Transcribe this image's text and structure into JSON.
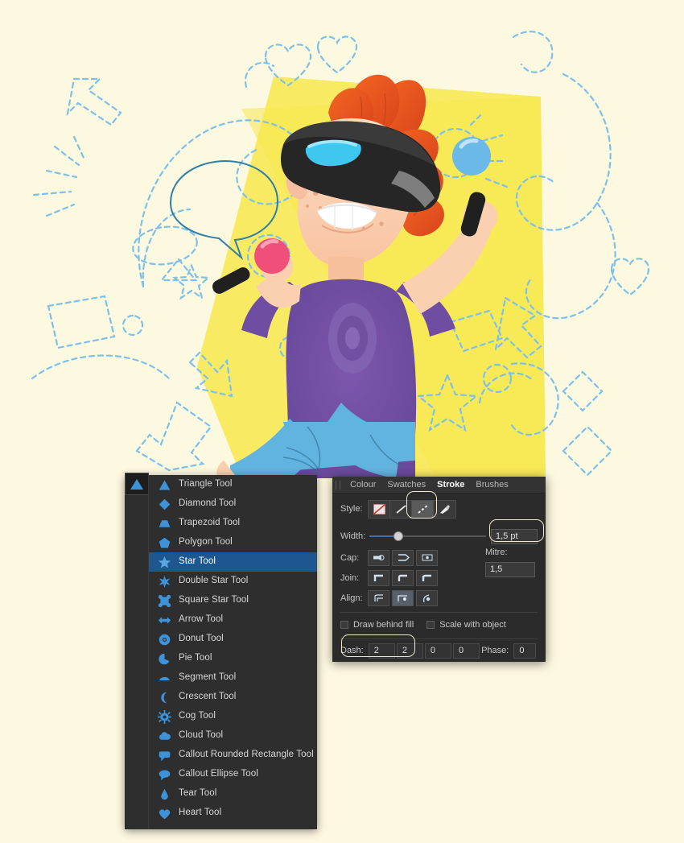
{
  "app": {
    "illustration_alt": "Cartoon boy with orange hair wearing a VR headset holding two controllers, yellow backdrop with dashed blue vector shapes"
  },
  "colors": {
    "page_background": "#fdf8e0",
    "backdrop_yellow": "#f7e94f",
    "dashed_stroke": "#6fb7e8",
    "hair_orange": "#e8561f",
    "shirt_purple": "#6f4da0",
    "jeans_blue": "#62b4e0",
    "skin": "#fbd0b0",
    "headset_black": "#2b2b2b",
    "headset_glow": "#3ec8f0",
    "controller_pink": "#ef4f78",
    "controller_blue": "#6bb9e8",
    "menu_background": "#2e2e2e",
    "menu_selected": "#1e568f",
    "panel_background": "#2b2b2b",
    "icon_blue": "#3e93d8"
  },
  "tool_menu": {
    "current_tool_icon": "triangle-icon",
    "items": [
      {
        "label": "Triangle Tool",
        "icon": "triangle-icon",
        "selected": false
      },
      {
        "label": "Diamond Tool",
        "icon": "diamond-icon",
        "selected": false
      },
      {
        "label": "Trapezoid Tool",
        "icon": "trapezoid-icon",
        "selected": false
      },
      {
        "label": "Polygon Tool",
        "icon": "polygon-icon",
        "selected": false
      },
      {
        "label": "Star Tool",
        "icon": "star-icon",
        "selected": true
      },
      {
        "label": "Double Star Tool",
        "icon": "double-star-icon",
        "selected": false
      },
      {
        "label": "Square Star Tool",
        "icon": "square-star-icon",
        "selected": false
      },
      {
        "label": "Arrow Tool",
        "icon": "arrow-icon",
        "selected": false
      },
      {
        "label": "Donut Tool",
        "icon": "donut-icon",
        "selected": false
      },
      {
        "label": "Pie Tool",
        "icon": "pie-icon",
        "selected": false
      },
      {
        "label": "Segment Tool",
        "icon": "segment-icon",
        "selected": false
      },
      {
        "label": "Crescent Tool",
        "icon": "crescent-icon",
        "selected": false
      },
      {
        "label": "Cog Tool",
        "icon": "cog-icon",
        "selected": false
      },
      {
        "label": "Cloud Tool",
        "icon": "cloud-icon",
        "selected": false
      },
      {
        "label": "Callout Rounded Rectangle Tool",
        "icon": "callout-rounded-rect-icon",
        "selected": false
      },
      {
        "label": "Callout Ellipse Tool",
        "icon": "callout-ellipse-icon",
        "selected": false
      },
      {
        "label": "Tear Tool",
        "icon": "tear-icon",
        "selected": false
      },
      {
        "label": "Heart Tool",
        "icon": "heart-icon",
        "selected": false
      }
    ]
  },
  "stroke_panel": {
    "tabs": [
      {
        "label": "Colour",
        "active": false
      },
      {
        "label": "Swatches",
        "active": false
      },
      {
        "label": "Stroke",
        "active": true
      },
      {
        "label": "Brushes",
        "active": false
      }
    ],
    "style": {
      "label": "Style:",
      "options": [
        {
          "name": "no-stroke",
          "selected": false
        },
        {
          "name": "solid-line",
          "selected": false
        },
        {
          "name": "dashed-line",
          "selected": true
        },
        {
          "name": "brush-stroke",
          "selected": false
        }
      ]
    },
    "width": {
      "label": "Width:",
      "value": "1,5 pt",
      "slider_percent": 25
    },
    "cap": {
      "label": "Cap:",
      "options": [
        {
          "name": "butt-cap",
          "selected": false
        },
        {
          "name": "round-cap",
          "selected": false
        },
        {
          "name": "square-cap",
          "selected": false
        }
      ]
    },
    "join": {
      "label": "Join:",
      "options": [
        {
          "name": "miter-join",
          "selected": false
        },
        {
          "name": "round-join",
          "selected": false
        },
        {
          "name": "bevel-join",
          "selected": false
        }
      ]
    },
    "align": {
      "label": "Align:",
      "options": [
        {
          "name": "align-centre",
          "selected": false
        },
        {
          "name": "align-inside",
          "selected": true
        },
        {
          "name": "align-outside",
          "selected": false
        }
      ]
    },
    "mitre": {
      "label": "Mitre:",
      "value": "1,5"
    },
    "checkboxes": [
      {
        "label": "Draw behind fill",
        "checked": false
      },
      {
        "label": "Scale with object",
        "checked": false
      }
    ],
    "dash": {
      "label": "Dash:",
      "values": [
        "2",
        "2",
        "0",
        "0"
      ],
      "phase_label": "Phase:",
      "phase_value": "0"
    }
  }
}
